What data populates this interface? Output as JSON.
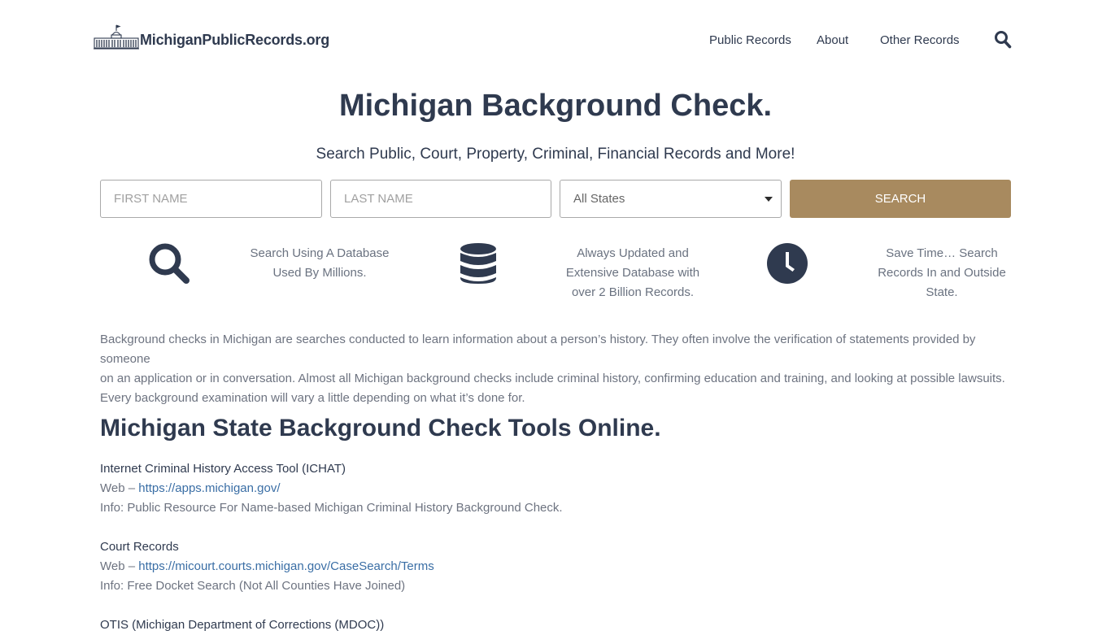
{
  "header": {
    "logo_text": "MichiganPublicRecords.org",
    "nav": [
      {
        "label": "Public Records"
      },
      {
        "label": "About"
      },
      {
        "label": "Other Records"
      }
    ],
    "search_icon": "search-icon"
  },
  "hero": {
    "title": "Michigan Background Check.",
    "subtitle": "Search Public, Court, Property, Criminal, Financial Records and More!"
  },
  "search": {
    "first_name_placeholder": "FIRST NAME",
    "last_name_placeholder": "LAST NAME",
    "state_selected": "All States",
    "button_label": "SEARCH",
    "button_color": "#a88a5f"
  },
  "features": [
    {
      "icon": "search-icon",
      "line1": "Search Using A Database",
      "line2": "Used By Millions.",
      "line3": ""
    },
    {
      "icon": "database-icon",
      "line1": "Always Updated and",
      "line2": "Extensive Database with",
      "line3": "over 2 Billion Records."
    },
    {
      "icon": "clock-icon",
      "line1": "Save Time… Search",
      "line2": "Records In and Outside",
      "line3": "State."
    }
  ],
  "intro": {
    "line1": "Background checks in Michigan are searches conducted to learn information about a person’s history. They often involve the verification of statements provided by someone",
    "line2": "on an application or in conversation. Almost all Michigan background checks include criminal history, confirming education and training, and looking at possible lawsuits.",
    "line3": "Every background examination will vary a little depending on what it’s done for."
  },
  "section": {
    "title": "Michigan State Background Check Tools Online."
  },
  "resources": [
    {
      "name": "Internet Criminal History Access Tool (ICHAT)",
      "web_prefix": "Web – ",
      "url": "https://apps.michigan.gov/",
      "info": "Info: Public Resource For Name-based Michigan Criminal History Background Check."
    },
    {
      "name": "Court Records",
      "web_prefix": "Web – ",
      "url": "https://micourt.courts.michigan.gov/CaseSearch/Terms",
      "info": "Info: Free Docket Search (Not All Counties Have Joined)"
    },
    {
      "name": "OTIS (Michigan Department of Corrections (MDOC))"
    }
  ],
  "colors": {
    "text_dark": "#2f3a4f",
    "text_muted": "#6d7380",
    "link": "#3a6ea5",
    "accent": "#a88a5f"
  }
}
